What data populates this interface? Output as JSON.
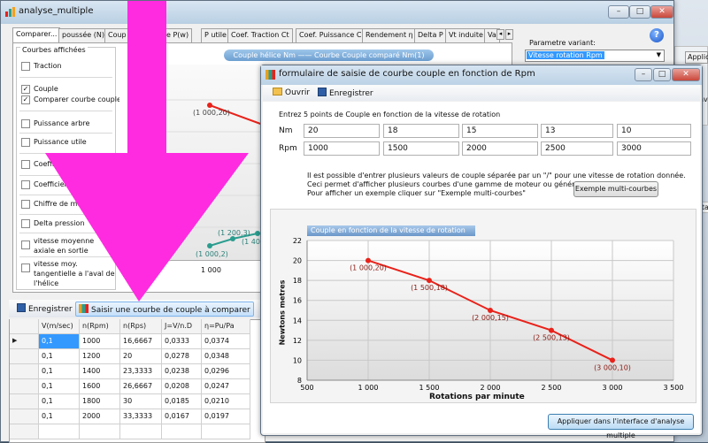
{
  "main_window": {
    "title": "analyse_multiple",
    "tabs": [
      "Comparer...",
      "poussée (N)",
      "Coup",
      "ore P(w)",
      "P utile",
      "Coef. Traction Ct",
      "Coef. Puissance Cp",
      "Rendement η",
      "Delta P",
      "Vt induite",
      "Va"
    ],
    "param_label": "Parametre variant:",
    "param_value": "Vitesse rotation Rpm",
    "group_label": "Courbes affichées",
    "checkboxes": [
      {
        "label": "Traction",
        "checked": false
      },
      {
        "label": "Couple",
        "checked": true
      },
      {
        "label": "Comparer courbe couple",
        "checked": true
      },
      {
        "label": "Puissance arbre",
        "checked": false
      },
      {
        "label": "Puissance utile",
        "checked": false
      },
      {
        "label": "Coefficient traction C",
        "checked": false
      },
      {
        "label": "Coefficient puissance",
        "checked": false
      },
      {
        "label": "Chiffre de merite",
        "checked": false
      },
      {
        "label": "Delta pression",
        "checked": false
      },
      {
        "label": "vitesse moyenne axiale en sortie",
        "checked": false
      },
      {
        "label": "vitesse moy. tangentielle a l'aval de l'hélice",
        "checked": false
      }
    ],
    "legend": "Couple hélice Nm  ——  Courbe Couple comparé Nm(1)",
    "bg_labels": {
      "p1": "(1 000,20)",
      "p2": "(1 200,3)",
      "p3": "(1 40",
      "p4": "(1 000,2)",
      "x500": "500",
      "x1000": "1 000"
    },
    "save_label": "Enregistrer",
    "enter_curve_label": "Saisir une courbe de couple à comparer",
    "table_headers": [
      "V(m/sec)",
      "n(Rpm)",
      "n(Rps)",
      "J=V/n.D",
      "η=Pu/Pa"
    ],
    "table_rows": [
      [
        "0,1",
        "1000",
        "16,6667",
        "0,0333",
        "0,0374"
      ],
      [
        "0,1",
        "1200",
        "20",
        "0,0278",
        "0,0348"
      ],
      [
        "0,1",
        "1400",
        "23,3333",
        "0,0238",
        "0,0296"
      ],
      [
        "0,1",
        "1600",
        "26,6667",
        "0,0208",
        "0,0247"
      ],
      [
        "0,1",
        "1800",
        "30",
        "0,0185",
        "0,0210"
      ],
      [
        "0,1",
        "2000",
        "33,3333",
        "0,0167",
        "0,0197"
      ],
      [
        "",
        "",
        "",
        "",
        ""
      ]
    ],
    "side_labels": {
      "app": "Applic",
      "sav": "Sav",
      "meta": "Meta",
      "er": "er"
    }
  },
  "dialog": {
    "title": "formulaire de saisie de courbe couple en fonction de Rpm",
    "open_label": "Ouvrir",
    "save_label": "Enregistrer",
    "instruction": "Entrez 5 points de Couple en fonction de la vitesse de rotation",
    "row1_label": "Nm",
    "row1_values": [
      "20",
      "18",
      "15",
      "13",
      "10"
    ],
    "row2_label": "Rpm",
    "row2_values": [
      "1000",
      "1500",
      "2000",
      "2500",
      "3000"
    ],
    "info_lines": [
      "Il est possible d'entrer plusieurs valeurs de couple séparée par un \"/\" pour une vitesse de rotation donnée.",
      "Ceci permet d'afficher plusieurs courbes d'une gamme de moteur ou générateurs.",
      "Pour afficher un exemple cliquer sur \"Exemple multi-courbes\""
    ],
    "example_button": "Exemple multi-courbes",
    "apply_button": "Appliquer dans l'interface d'analyse multiple"
  },
  "colors": {
    "series": "#e8221a",
    "teal_series": "#2a9d8f",
    "magenta_arrow": "#ff2be0",
    "highlight": "#3399ff"
  },
  "chart_data": {
    "type": "line",
    "title": "Couple en fonction de la vitesse de rotation",
    "xlabel": "Rotations par minute",
    "ylabel": "Newtons metres",
    "x": [
      1000,
      1500,
      2000,
      2500,
      3000
    ],
    "y": [
      20,
      18,
      15,
      13,
      10
    ],
    "point_labels": [
      "(1 000,20)",
      "(1 500,18)",
      "(2 000,15)",
      "(2 500,13)",
      "(3 000,10)"
    ],
    "xlim": [
      500,
      3500
    ],
    "ylim": [
      8,
      22
    ],
    "xticks": [
      "500",
      "1 000",
      "1 500",
      "2 000",
      "2 500",
      "3 000",
      "3 500"
    ],
    "yticks": [
      "8",
      "10",
      "12",
      "14",
      "16",
      "18",
      "20",
      "22"
    ],
    "grid": true
  }
}
